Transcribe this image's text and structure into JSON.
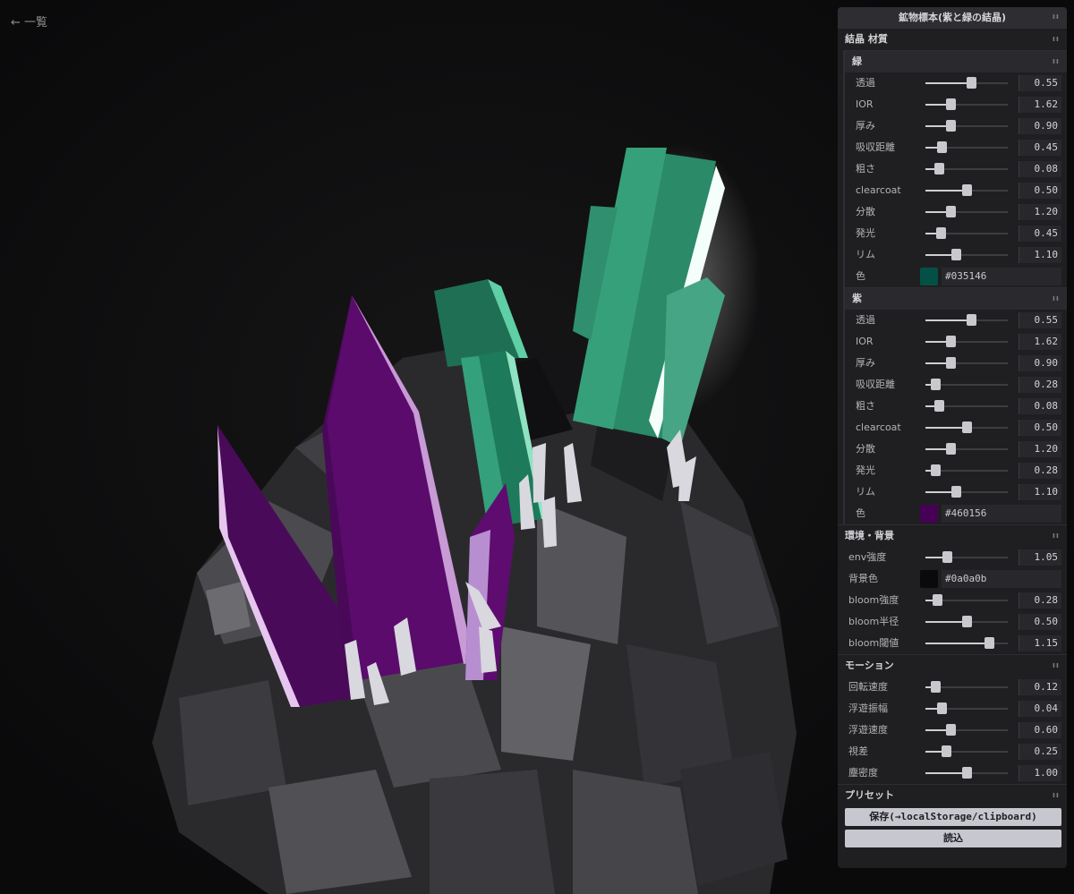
{
  "back_link": "← 一覧",
  "gui": {
    "title": "鉱物標本(紫と緑の結晶)",
    "collapse_glyph": "ıı",
    "crystal_folder": {
      "title": "結晶 材質",
      "green": {
        "title": "緑",
        "rows": [
          {
            "label": "透過",
            "value": "0.55",
            "fill": 0.55
          },
          {
            "label": "IOR",
            "value": "1.62",
            "fill": 0.3
          },
          {
            "label": "厚み",
            "value": "0.90",
            "fill": 0.3
          },
          {
            "label": "吸収距離",
            "value": "0.45",
            "fill": 0.2
          },
          {
            "label": "粗さ",
            "value": "0.08",
            "fill": 0.16
          },
          {
            "label": "clearcoat",
            "value": "0.50",
            "fill": 0.5
          },
          {
            "label": "分散",
            "value": "1.20",
            "fill": 0.3
          },
          {
            "label": "発光",
            "value": "0.45",
            "fill": 0.18
          },
          {
            "label": "リム",
            "value": "1.10",
            "fill": 0.37
          }
        ],
        "color_label": "色",
        "color_value": "#035146",
        "swatch": "#035146"
      },
      "purple": {
        "title": "紫",
        "rows": [
          {
            "label": "透過",
            "value": "0.55",
            "fill": 0.55
          },
          {
            "label": "IOR",
            "value": "1.62",
            "fill": 0.3
          },
          {
            "label": "厚み",
            "value": "0.90",
            "fill": 0.3
          },
          {
            "label": "吸収距離",
            "value": "0.28",
            "fill": 0.12
          },
          {
            "label": "粗さ",
            "value": "0.08",
            "fill": 0.16
          },
          {
            "label": "clearcoat",
            "value": "0.50",
            "fill": 0.5
          },
          {
            "label": "分散",
            "value": "1.20",
            "fill": 0.3
          },
          {
            "label": "発光",
            "value": "0.28",
            "fill": 0.12
          },
          {
            "label": "リム",
            "value": "1.10",
            "fill": 0.37
          }
        ],
        "color_label": "色",
        "color_value": "#460156",
        "swatch": "#460156"
      }
    },
    "env_folder": {
      "title": "環境・背景",
      "rows_a": [
        {
          "label": "env強度",
          "value": "1.05",
          "fill": 0.26
        }
      ],
      "bg_label": "背景色",
      "bg_value": "#0a0a0b",
      "bg_swatch": "#0a0a0b",
      "rows_b": [
        {
          "label": "bloom強度",
          "value": "0.28",
          "fill": 0.14
        },
        {
          "label": "bloom半径",
          "value": "0.50",
          "fill": 0.5
        },
        {
          "label": "bloom閾値",
          "value": "1.15",
          "fill": 0.77
        }
      ]
    },
    "motion_folder": {
      "title": "モーション",
      "rows": [
        {
          "label": "回転速度",
          "value": "0.12",
          "fill": 0.12
        },
        {
          "label": "浮遊振幅",
          "value": "0.04",
          "fill": 0.2
        },
        {
          "label": "浮遊速度",
          "value": "0.60",
          "fill": 0.3
        },
        {
          "label": "視差",
          "value": "0.25",
          "fill": 0.25
        },
        {
          "label": "塵密度",
          "value": "1.00",
          "fill": 0.5
        }
      ]
    },
    "preset_folder": {
      "title": "プリセット",
      "save_label": "保存(→localStorage/clipboard)",
      "load_label": "読込"
    }
  },
  "colors": {
    "background": "#0a0a0b",
    "green_crystal": "#2c8a6a",
    "purple_crystal": "#5a0a6a",
    "rock": "#3a3a3e"
  }
}
